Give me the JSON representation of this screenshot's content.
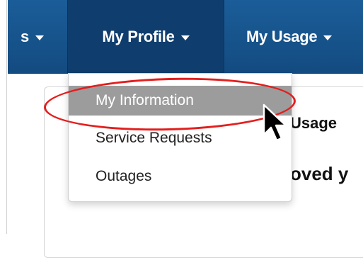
{
  "nav": {
    "left_partial_label": "s",
    "profile_label": "My Profile",
    "usage_label": "My Usage"
  },
  "dropdown": {
    "items": [
      {
        "label": "My Information"
      },
      {
        "label": "Service Requests"
      },
      {
        "label": "Outages"
      }
    ]
  },
  "background_content": {
    "usage_heading_partial": "Usage",
    "approved_partial": "oved y"
  },
  "colors": {
    "navbar": "#1b5d99",
    "active_tab": "#0f3e6e",
    "highlight": "#9c9c9c",
    "annotation": "#e41e1e"
  },
  "icons": [
    "chevron-down-icon",
    "mouse-pointer-icon"
  ]
}
